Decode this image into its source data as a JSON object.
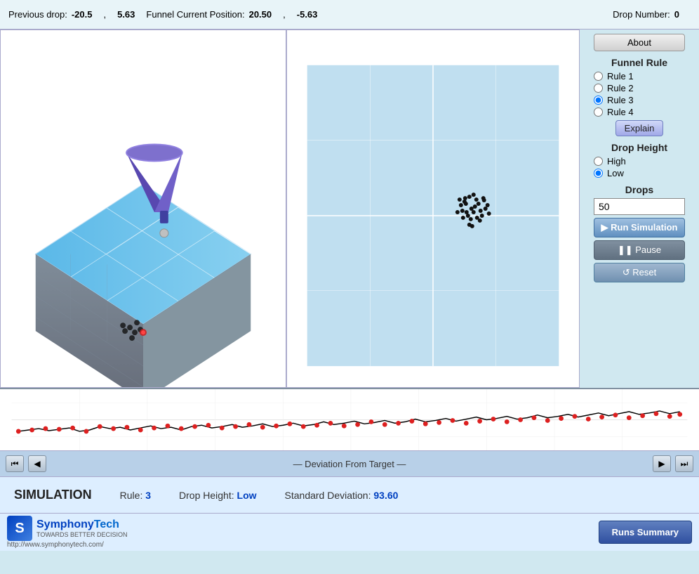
{
  "header": {
    "prev_drop_label": "Previous drop:",
    "prev_drop_x": "-20.5",
    "comma1": ",",
    "prev_drop_y": "5.63",
    "funnel_label": "Funnel Current Position:",
    "funnel_x": "20.50",
    "comma2": ",",
    "funnel_y": "-5.63",
    "drop_number_label": "Drop Number:",
    "drop_number": "0"
  },
  "right_panel": {
    "about_label": "About",
    "funnel_rule_title": "Funnel Rule",
    "rules": [
      {
        "id": "rule1",
        "label": "Rule 1",
        "checked": false
      },
      {
        "id": "rule2",
        "label": "Rule 2",
        "checked": false
      },
      {
        "id": "rule3",
        "label": "Rule 3",
        "checked": true
      },
      {
        "id": "rule4",
        "label": "Rule 4",
        "checked": false
      }
    ],
    "explain_label": "Explain",
    "drop_height_title": "Drop Height",
    "heights": [
      {
        "id": "high",
        "label": "High",
        "checked": false
      },
      {
        "id": "low",
        "label": "Low",
        "checked": true
      }
    ],
    "drops_title": "Drops",
    "drops_value": "50",
    "run_label": "▶ Run Simulation",
    "pause_label": "❚❚ Pause",
    "reset_label": "↺ Reset"
  },
  "deviation": {
    "label": "— Deviation From Target —"
  },
  "simulation": {
    "title": "SIMULATION",
    "rule_label": "Rule:",
    "rule_value": "3",
    "drop_height_label": "Drop Height:",
    "drop_height_value": "Low",
    "std_dev_label": "Standard Deviation:",
    "std_dev_value": "93.60"
  },
  "footer": {
    "logo_main": "SymphonyTech",
    "logo_sub": "TOWARDS BETTER DECISION",
    "logo_url": "http://www.symphonytech.com/",
    "runs_summary_label": "Runs Summary"
  },
  "icons": {
    "play_first": "⏮",
    "play_prev": "◀",
    "play_next": "▶",
    "play_last": "⏭"
  }
}
